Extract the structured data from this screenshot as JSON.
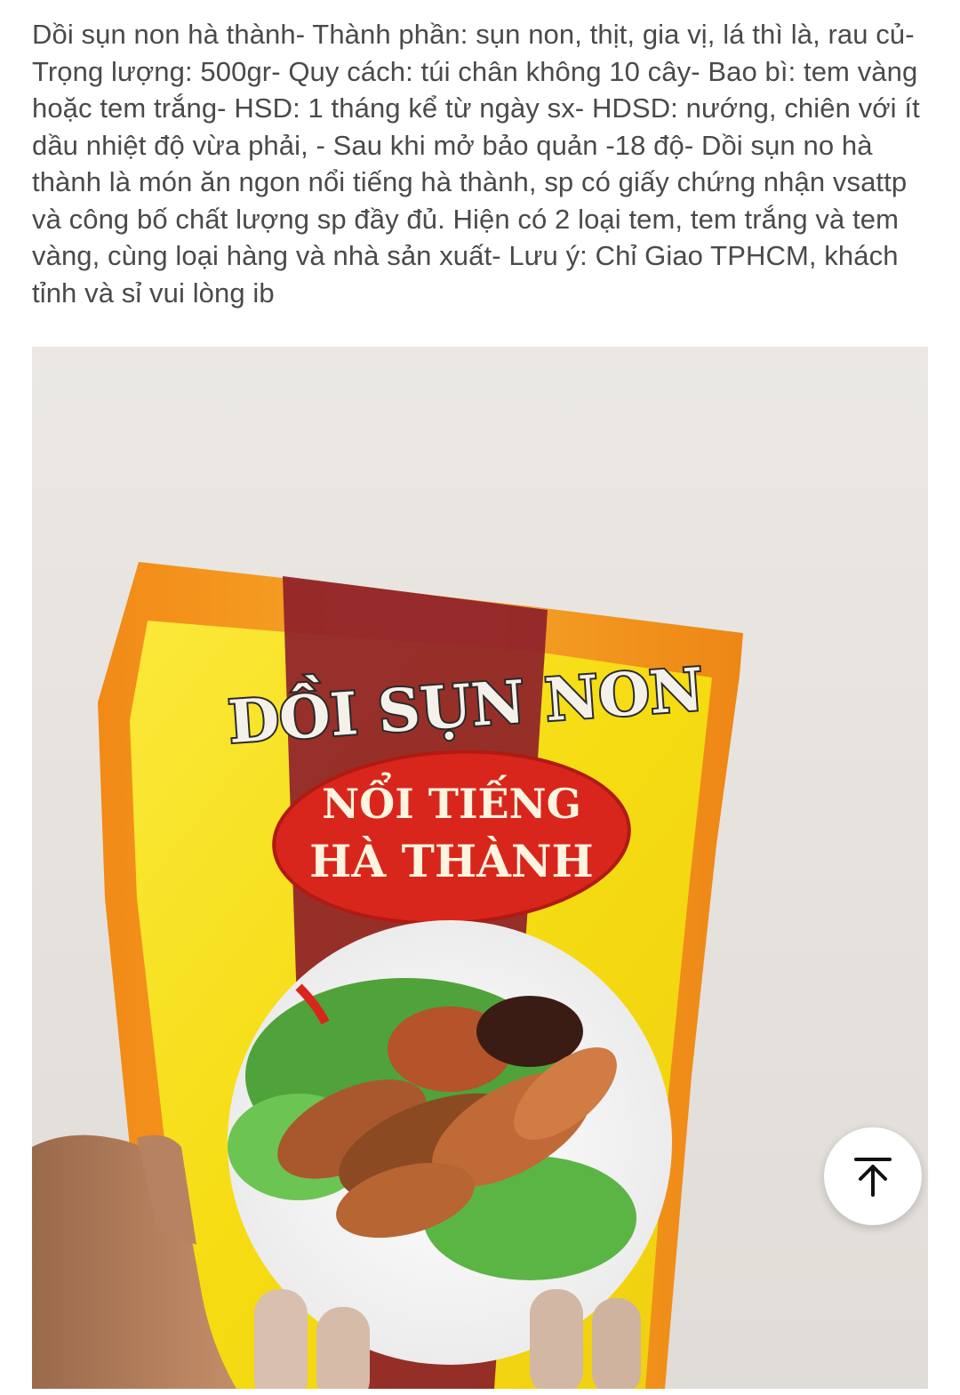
{
  "post": {
    "description": "Dồi sụn non hà thành- Thành phần: sụn non, thịt, gia vị, lá thì là, rau củ- Trọng lượng: 500gr- Quy cách: túi chân không 10 cây- Bao bì: tem vàng hoặc tem trắng- HSD: 1 tháng kể từ ngày sx- HDSD: nướng, chiên với ít dầu nhiệt độ vừa phải, - Sau khi mở bảo quản -18 độ- Dồi sụn no hà thành là món ăn ngon nổi tiếng hà thành, sp có giấy chứng nhận vsattp và công bố chất lượng sp đầy đủ. Hiện có 2 loại tem, tem trắng và tem vàng, cùng loại hàng và nhà sản xuất- Lưu ý: Chỉ Giao TPHCM, khách tỉnh và sỉ vui lòng ib"
  },
  "product_image": {
    "brand_title": "DỒI SỤN NON",
    "banner_line1": "NỔI TIẾNG",
    "banner_line2": "HÀ THÀNH"
  },
  "scroll_top_button": {
    "icon": "arrow-up-to-top-icon"
  },
  "colors": {
    "text": "#4a4a4a",
    "package_orange": "#f39a1e",
    "package_yellow": "#f7e21a",
    "banner_red": "#d8261c",
    "background": "#ffffff"
  }
}
